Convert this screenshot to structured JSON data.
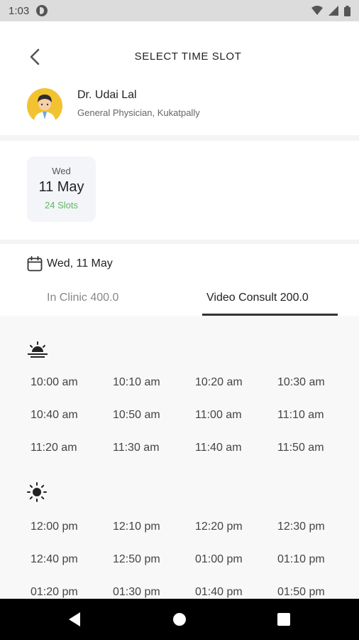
{
  "status_bar": {
    "time": "1:03"
  },
  "header": {
    "title": "SELECT TIME SLOT",
    "doctor_name": "Dr. Udai Lal",
    "doctor_subtitle": "General Physician, Kukatpally"
  },
  "date_card": {
    "day": "Wed",
    "date": "11 May",
    "slots": "24 Slots"
  },
  "selected_date": "Wed, 11 May",
  "tabs": [
    {
      "label": "In Clinic 400.0",
      "active": false
    },
    {
      "label": "Video Consult 200.0",
      "active": true
    }
  ],
  "morning": {
    "icon": "sunrise-icon",
    "slots": [
      "10:00 am",
      "10:10 am",
      "10:20 am",
      "10:30 am",
      "10:40 am",
      "10:50 am",
      "11:00 am",
      "11:10 am",
      "11:20 am",
      "11:30 am",
      "11:40 am",
      "11:50 am"
    ]
  },
  "afternoon": {
    "icon": "sun-icon",
    "slots": [
      "12:00 pm",
      "12:10 pm",
      "12:20 pm",
      "12:30 pm",
      "12:40 pm",
      "12:50 pm",
      "01:00 pm",
      "01:10 pm",
      "01:20 pm",
      "01:30 pm",
      "01:40 pm",
      "01:50 pm"
    ]
  },
  "colors": {
    "slots_green": "#5cb85c",
    "avatar_bg": "#f2c230",
    "tab_underline": "#333333"
  }
}
